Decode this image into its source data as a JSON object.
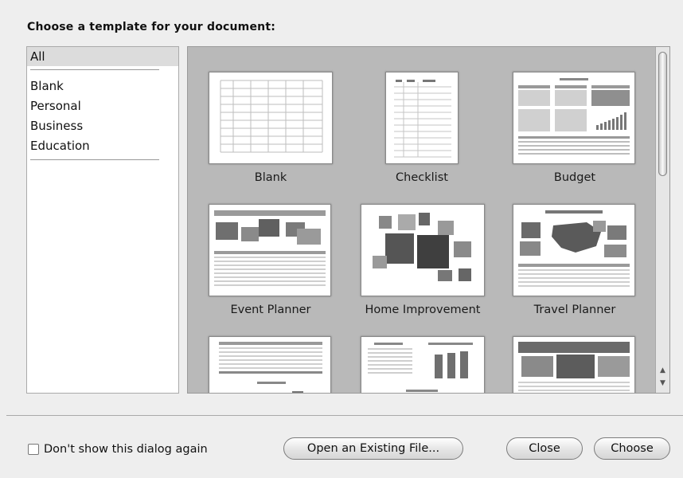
{
  "dialog": {
    "title": "Choose a template for your document:"
  },
  "categories": {
    "selected": "All",
    "items": [
      "Blank",
      "Personal",
      "Business",
      "Education"
    ]
  },
  "templates": [
    {
      "label": "Blank"
    },
    {
      "label": "Checklist"
    },
    {
      "label": "Budget"
    },
    {
      "label": "Event Planner"
    },
    {
      "label": "Home Improvement"
    },
    {
      "label": "Travel Planner"
    },
    {
      "label": ""
    },
    {
      "label": ""
    },
    {
      "label": ""
    }
  ],
  "footer": {
    "checkbox_label": "Don't show this dialog again",
    "checkbox_checked": false,
    "open_existing_label": "Open an Existing File...",
    "close_label": "Close",
    "choose_label": "Choose"
  },
  "icons": {
    "scroll_up": "scroll-up-arrow-icon",
    "scroll_down": "scroll-down-arrow-icon"
  }
}
